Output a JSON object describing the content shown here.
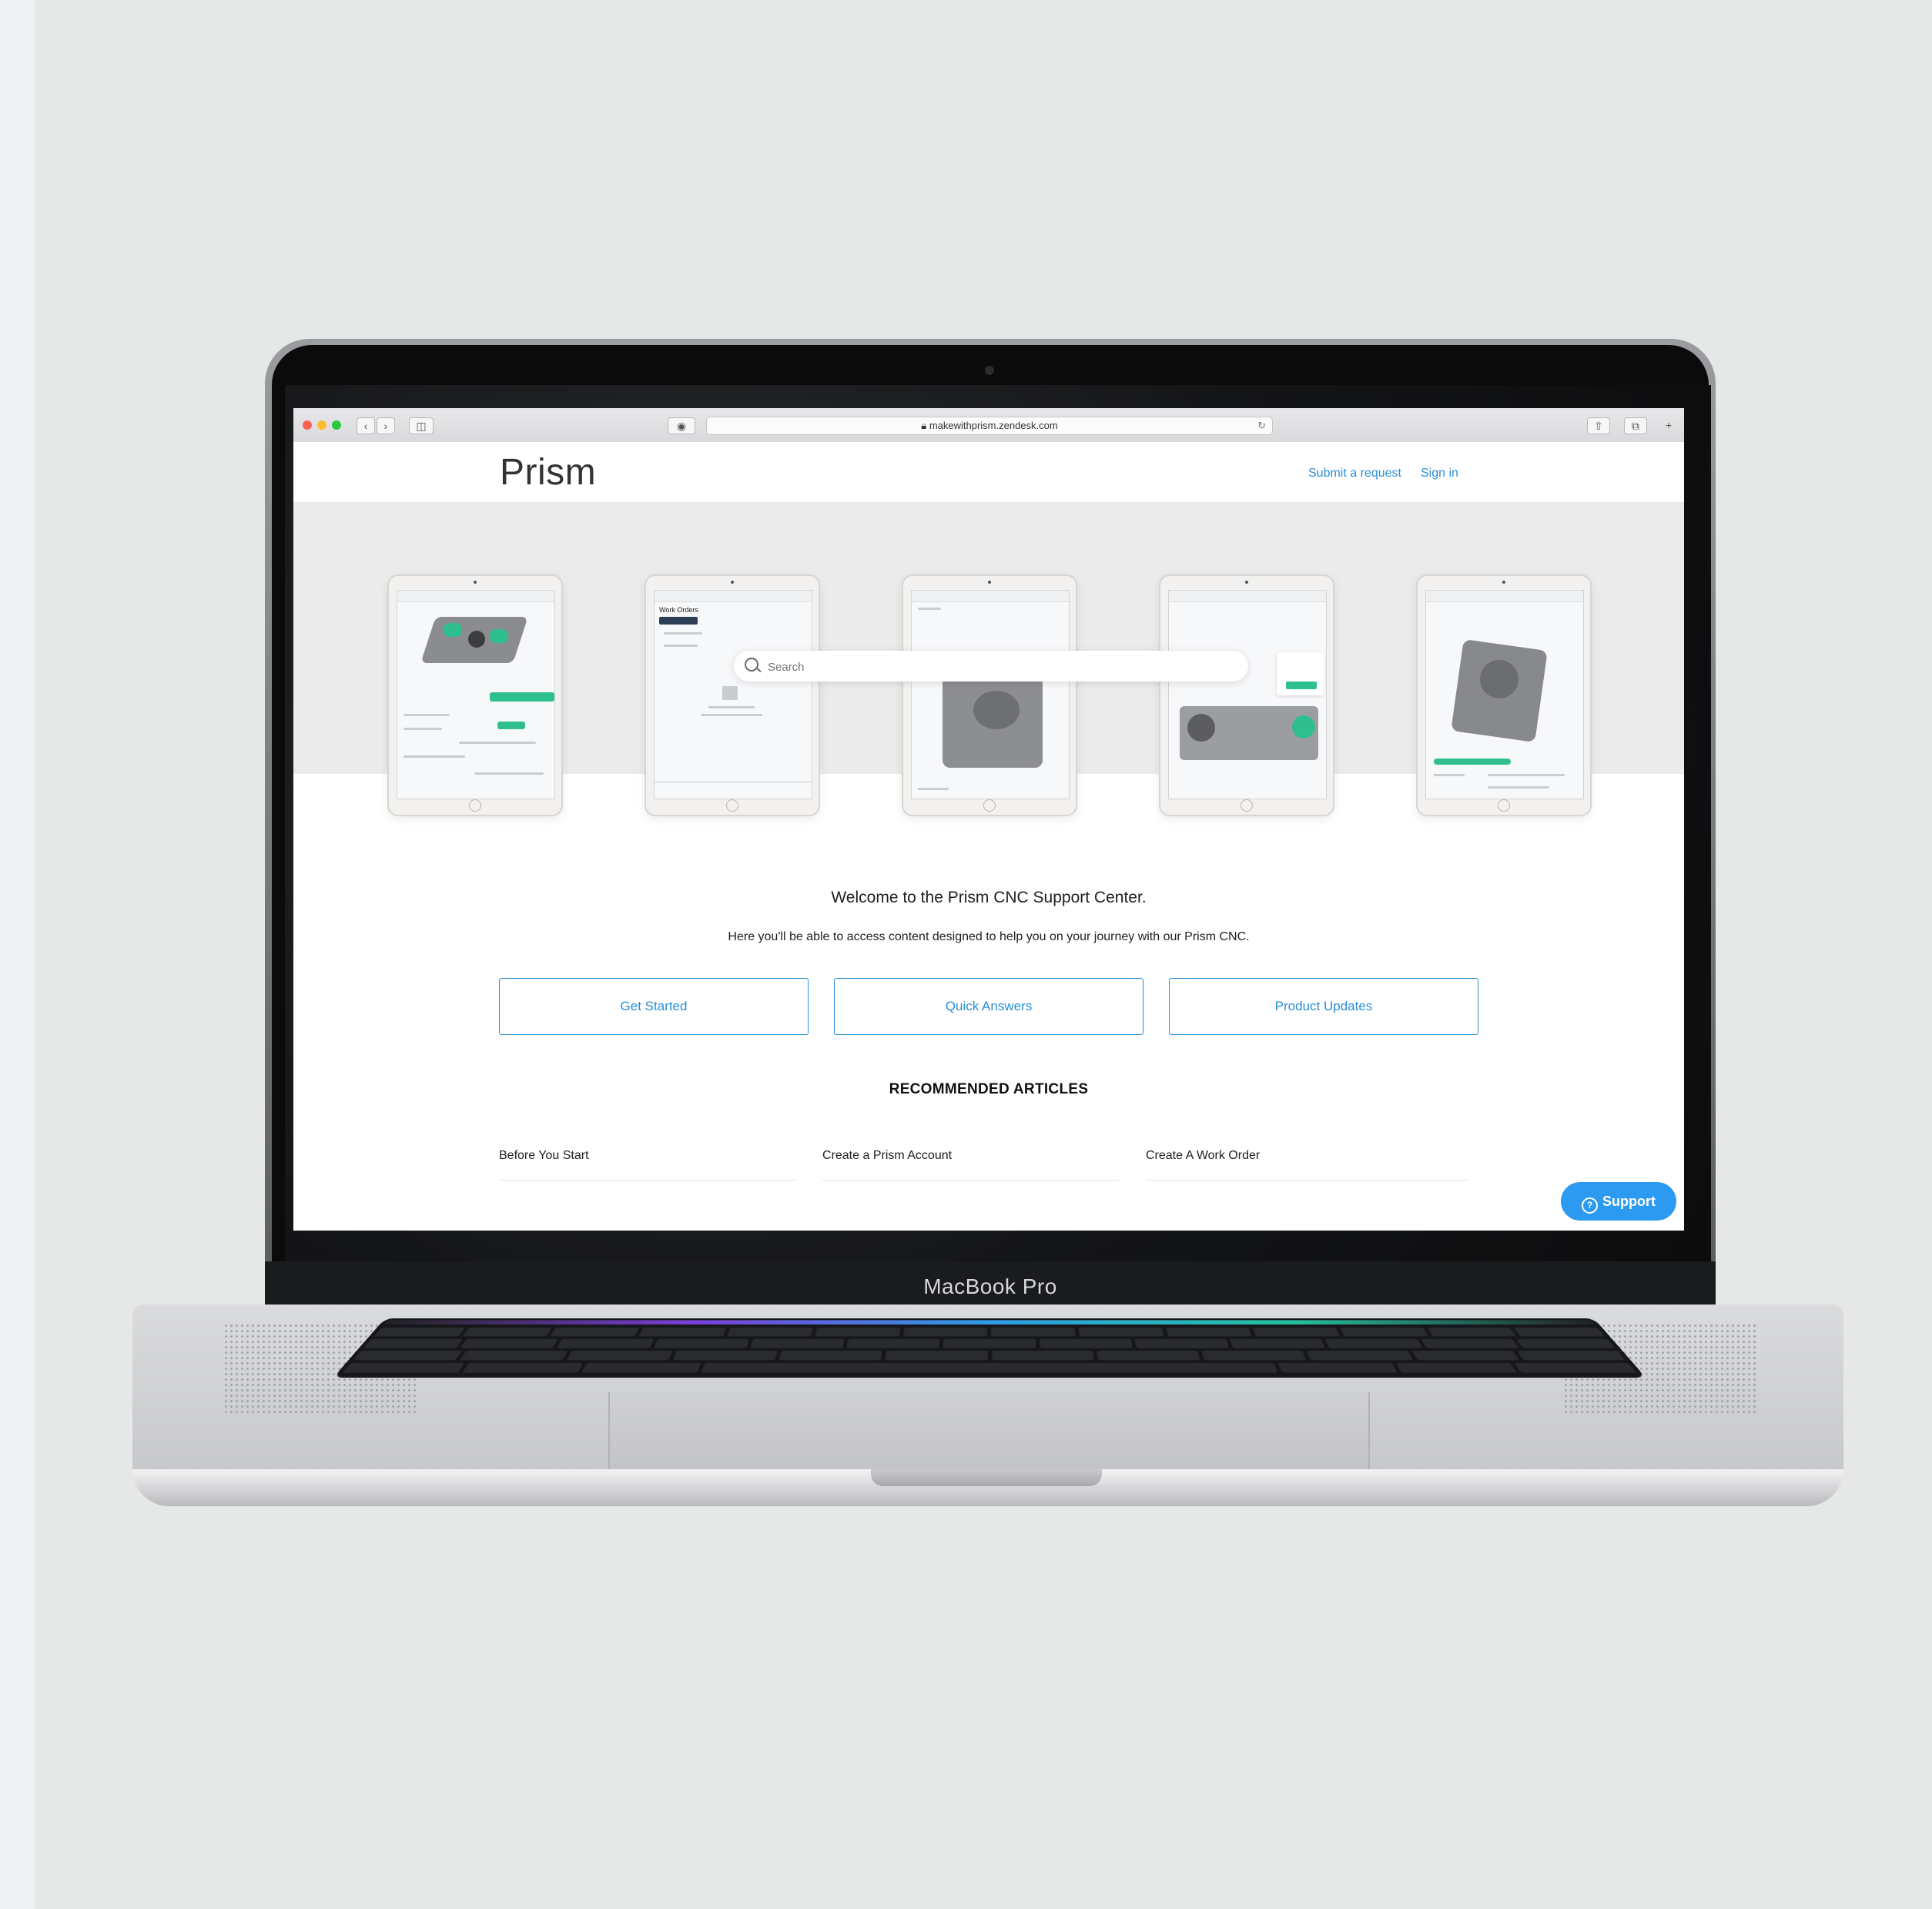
{
  "device": {
    "label": "MacBook Pro"
  },
  "browser": {
    "url": "makewithprism.zendesk.com"
  },
  "site": {
    "logo": "Prism",
    "nav": {
      "submit_request": "Submit a request",
      "sign_in": "Sign in"
    }
  },
  "search": {
    "placeholder": "Search"
  },
  "ipad_screens": {
    "work_orders_title": "Work Orders"
  },
  "welcome": {
    "heading": "Welcome to the Prism CNC Support Center.",
    "intro": "Here you'll be able to access content designed to help you on your journey with our Prism CNC."
  },
  "cta_buttons": [
    "Get Started",
    "Quick Answers",
    "Product Updates"
  ],
  "recommended": {
    "heading": "RECOMMENDED ARTICLES",
    "articles": [
      "Before You Start",
      "Create a Prism Account",
      "Create A Work Order"
    ]
  },
  "support_widget": {
    "label": "Support",
    "icon": "?"
  },
  "colors": {
    "accent": "#2a8fd6",
    "support_button": "#2b9af0",
    "ipad_green": "#2fbf8f"
  }
}
